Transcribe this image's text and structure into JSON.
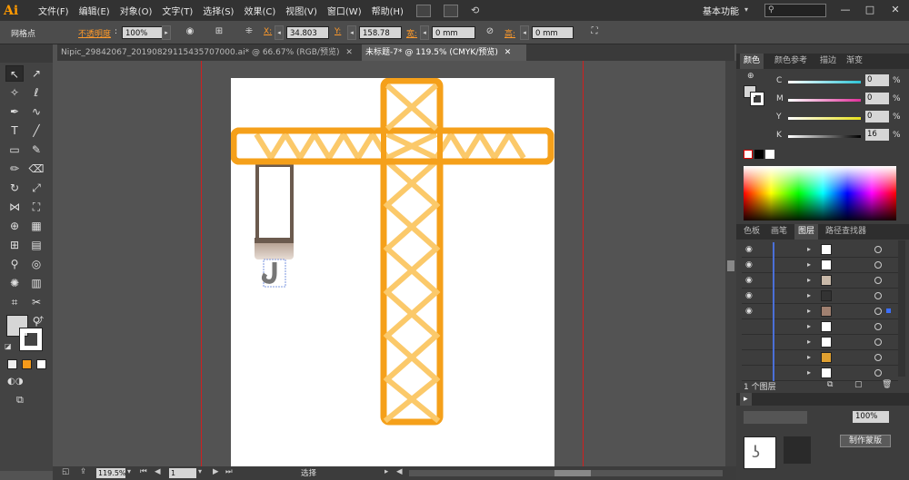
{
  "app": {
    "logo": "Ai",
    "workspace": "基本功能"
  },
  "menu": [
    "文件(F)",
    "编辑(E)",
    "对象(O)",
    "文字(T)",
    "选择(S)",
    "效果(C)",
    "视图(V)",
    "窗口(W)",
    "帮助(H)"
  ],
  "window_controls": {
    "minimize": "—",
    "restore": "□",
    "close": "✕"
  },
  "control_bar": {
    "selection_type": "网格点",
    "opacity_label": "不透明度",
    "opacity_value": "100%",
    "x_label": "X:",
    "x_value": "34.803",
    "y_label": "Y:",
    "y_value": "158.78",
    "w_label": "宽:",
    "w_value": "0 mm",
    "h_label": "高:",
    "h_value": "0 mm"
  },
  "tabs": [
    {
      "label": "Nipic_29842067_20190829115435707000.ai* @ 66.67% (RGB/预览)",
      "close": "✕",
      "active": false
    },
    {
      "label": "未标题-7* @ 119.5% (CMYK/预览)",
      "close": "✕",
      "active": true
    }
  ],
  "status_bar": {
    "zoom": "119.5%",
    "page": "1",
    "tool": "选择"
  },
  "color_panel": {
    "tabs": [
      "颜色",
      "颜色参考",
      "描边",
      "渐变"
    ],
    "channels": [
      {
        "label": "C",
        "value": "0",
        "color": "#2ec4d6"
      },
      {
        "label": "M",
        "value": "0",
        "color": "#e0309a"
      },
      {
        "label": "Y",
        "value": "0",
        "color": "#e6e01c"
      },
      {
        "label": "K",
        "value": "16",
        "color": "#999999"
      }
    ],
    "unit": "%"
  },
  "layers_panel": {
    "tabs": [
      "色板",
      "画笔",
      "图层",
      "路径查找器"
    ],
    "rows": 9,
    "footer": "1 个图层"
  },
  "transparency_panel": {
    "value": "100%",
    "make_mask": "制作蒙版"
  },
  "colors": {
    "crane_orange": "#f5a01a",
    "crane_light": "#fbc96a",
    "cable_brown": "#6b5a4e",
    "guide_red": "#d02020"
  }
}
